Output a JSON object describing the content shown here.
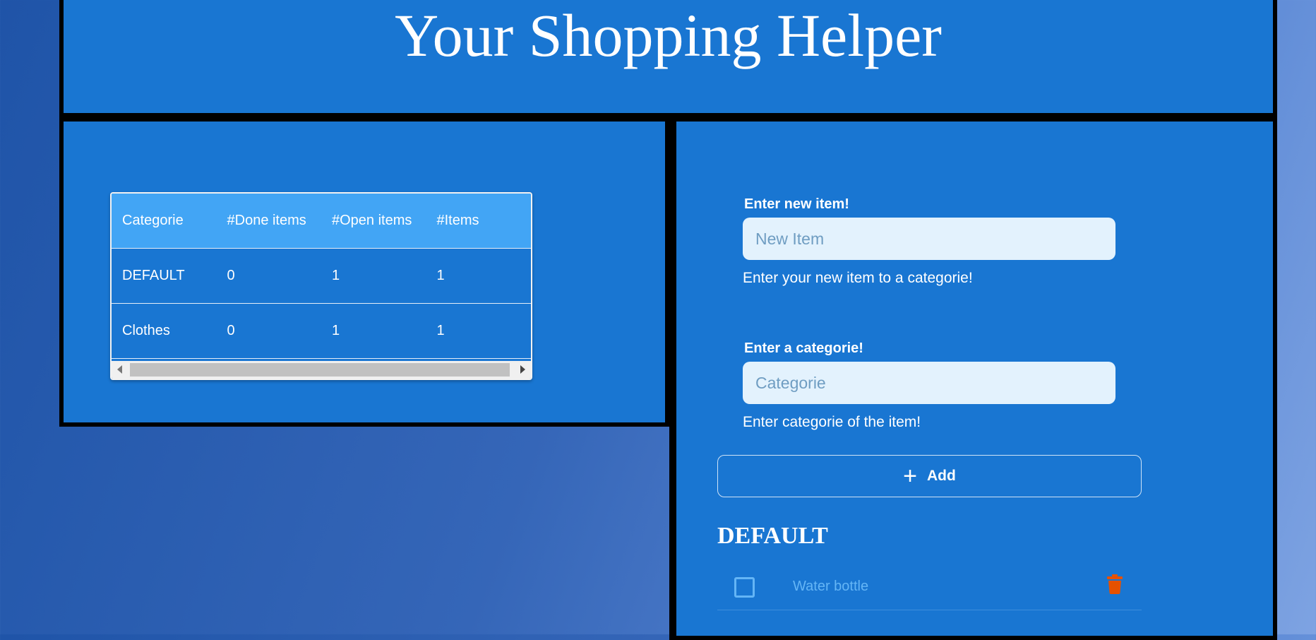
{
  "header": {
    "title": "Your Shopping Helper"
  },
  "stats_table": {
    "columns": [
      "Categorie",
      "#Done items",
      "#Open items",
      "#Items"
    ],
    "rows": [
      [
        "DEFAULT",
        "0",
        "1",
        "1"
      ],
      [
        "Clothes",
        "0",
        "1",
        "1"
      ]
    ]
  },
  "form": {
    "item_label": "Enter new item!",
    "item_placeholder": "New Item",
    "item_helper": "Enter your new item to a categorie!",
    "category_label": "Enter a categorie!",
    "category_placeholder": "Categorie",
    "category_helper": "Enter categorie of the item!",
    "add_label": "Add"
  },
  "list": {
    "category": "DEFAULT",
    "items": [
      {
        "name": "Water bottle",
        "done": false
      }
    ]
  },
  "colors": {
    "panel": "#1976d2",
    "table_header": "#42a5f5",
    "trash": "#e65100",
    "item_text": "#64b5f6"
  }
}
